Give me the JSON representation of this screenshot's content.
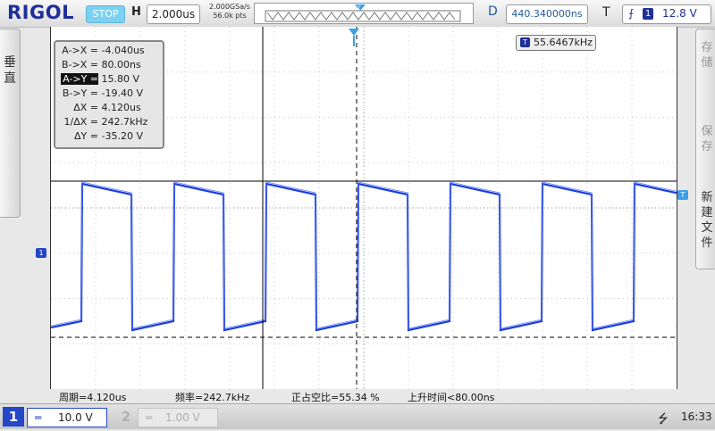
{
  "header": {
    "brand": "RIGOL",
    "run_state": "STOP",
    "h_label": "H",
    "timebase": "2.000us",
    "sample_rate": "2.000GSa/s",
    "memory_depth": "56.0k pts",
    "delay_label": "D",
    "delay": "440.340000ns",
    "trigger_label": "T",
    "trigger_edge_icon": "rising-edge-icon",
    "trigger_channel": "1",
    "trigger_level": "12.8 V"
  },
  "left_menu": {
    "label": "垂直"
  },
  "right_menu": {
    "buttons": [
      "存储",
      "保存",
      "新建文件"
    ]
  },
  "cursor_readout": {
    "rows": [
      {
        "label": "A->X =",
        "value": "-4.040us"
      },
      {
        "label": "B->X =",
        "value": "80.00ns"
      },
      {
        "label": "A->Y =",
        "value": "15.80 V",
        "selected": true
      },
      {
        "label": "B->Y =",
        "value": "-19.40 V"
      },
      {
        "label": "ΔX =",
        "value": "4.120us"
      },
      {
        "label": "1/ΔX =",
        "value": "242.7kHz"
      },
      {
        "label": "ΔY =",
        "value": "-35.20 V"
      }
    ]
  },
  "frequency_counter": {
    "icon": "T",
    "value": "55.6467kHz"
  },
  "markers": {
    "ch1": "1",
    "trigger": "T"
  },
  "measurements": {
    "period": "周期=4.120us",
    "frequency": "频率=242.7kHz",
    "duty": "正占空比=55.34 %",
    "rise_time": "上升时间<80.00ns"
  },
  "footer": {
    "ch1_number": "1",
    "ch1_coupling": "═",
    "ch1_scale": "10.0 V",
    "ch2_number": "2",
    "ch2_coupling": "═",
    "ch2_scale": "1.00 V",
    "usb_icon": "usb-icon",
    "time": "16:33"
  },
  "colors": {
    "brand": "#1f2f98",
    "waveform": "#1a3ee0",
    "run_state_bg": "#7cd0f0",
    "ch1": "#2446c8"
  }
}
